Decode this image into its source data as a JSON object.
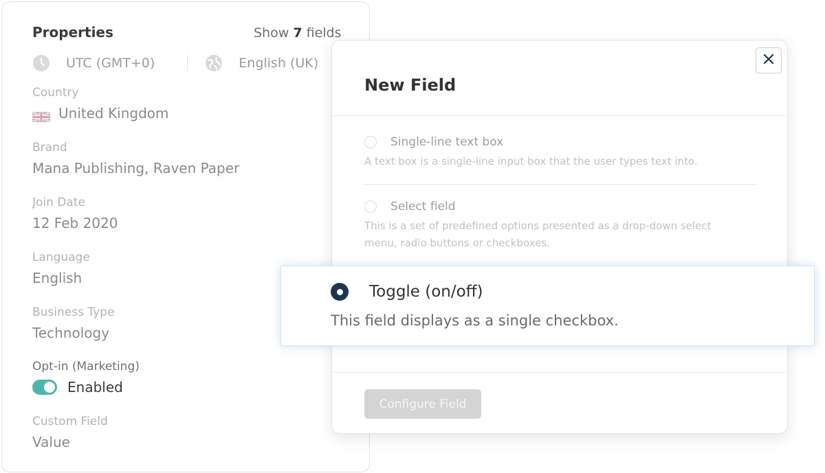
{
  "properties": {
    "title": "Properties",
    "show_prefix": "Show",
    "show_count": "7",
    "show_suffix": "fields",
    "timezone": "UTC (GMT+0)",
    "locale": "English (UK)",
    "fields": [
      {
        "label": "Country",
        "value": "United Kingdom"
      },
      {
        "label": "Brand",
        "value": "Mana Publishing, Raven Paper"
      },
      {
        "label": "Join Date",
        "value": "12 Feb 2020"
      },
      {
        "label": "Language",
        "value": "English"
      },
      {
        "label": "Business Type",
        "value": "Technology"
      },
      {
        "label": "Opt-in (Marketing)",
        "value": "Enabled"
      },
      {
        "label": "Custom Field",
        "value": "Value"
      }
    ]
  },
  "modal": {
    "title": "New Field",
    "options": [
      {
        "label": "Single-line text box",
        "description": "A text box is a single-line input box that the user types text into."
      },
      {
        "label": "Select field",
        "description_line1": "This is a set of predefined options presented as a drop-down select",
        "description_line2": "menu, radio buttons or checkboxes."
      }
    ],
    "selected_option": {
      "label": "Toggle (on/off)",
      "description": "This field displays as a single checkbox."
    },
    "configure_button": "Configure Field"
  },
  "colors": {
    "toggle_on": "#4db6ac",
    "radio_selected": "#1c3650",
    "button_disabled": "#d4d4d4"
  },
  "icons": [
    "clock-icon",
    "globe-icon",
    "uk-flag-icon",
    "close-icon",
    "radio-selected-icon"
  ]
}
